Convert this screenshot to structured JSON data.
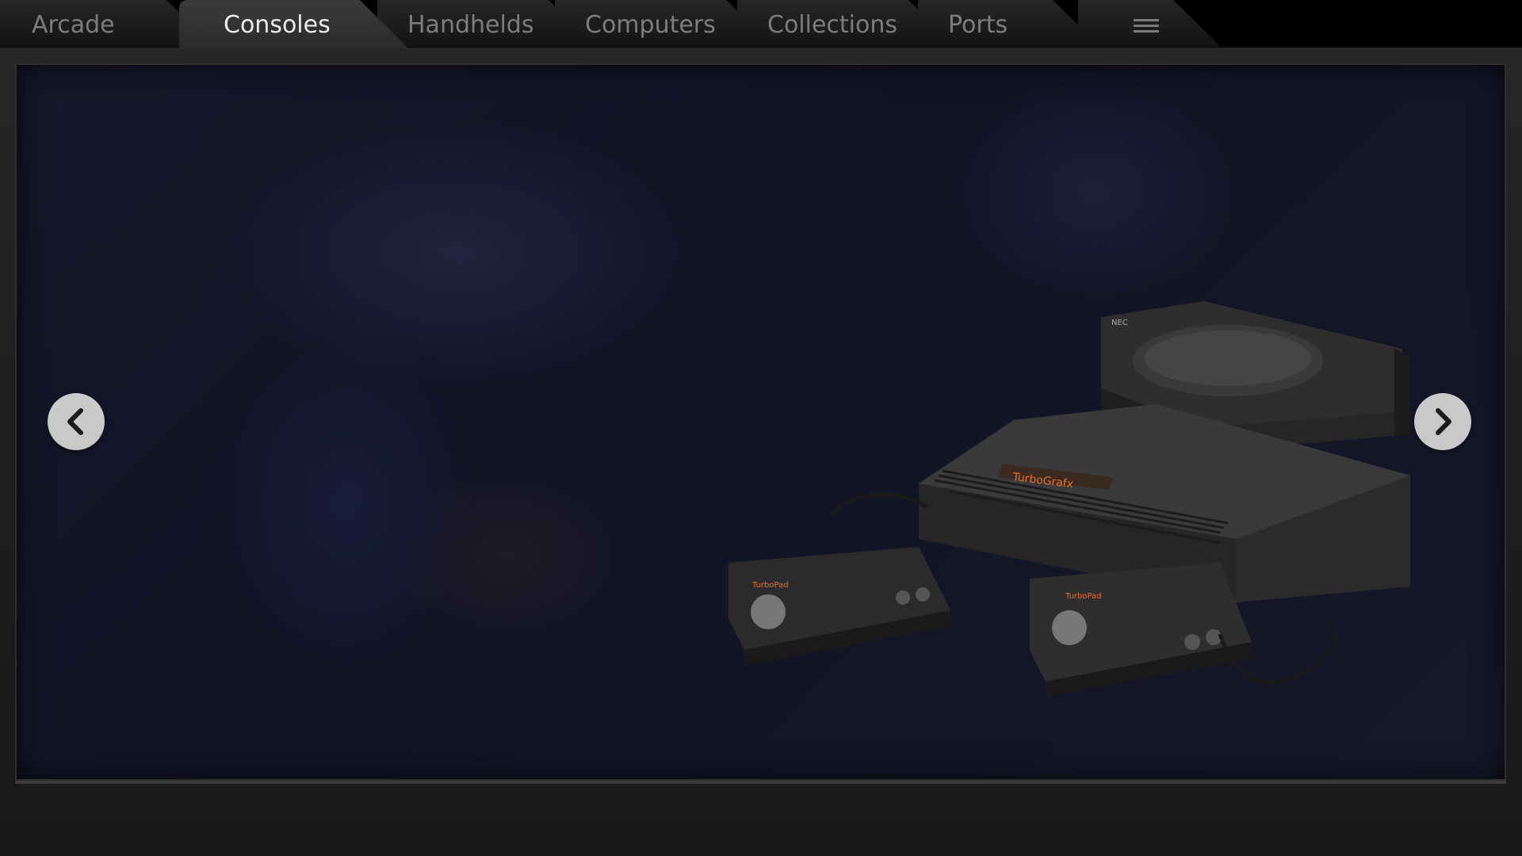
{
  "tabs": [
    {
      "label": "Arcade"
    },
    {
      "label": "Consoles"
    },
    {
      "label": "Handhelds"
    },
    {
      "label": "Computers"
    },
    {
      "label": "Collections"
    },
    {
      "label": "Ports"
    }
  ],
  "active_tab": "Consoles",
  "menu_icon": "hamburger-menu-icon",
  "carousel": {
    "prev_icon": "chevron-left-icon",
    "next_icon": "chevron-right-icon",
    "image_subject": "turbografx-console-icon",
    "console_brand_text": "TurboGrafx",
    "controller_text": "TurboPad",
    "cd_brand_text": "NEC"
  },
  "colors": {
    "tab_text": "#7d7d7d",
    "active_tab_text": "#ececec",
    "stage_bg": "#13162a",
    "nav_button": "#c9c9c9",
    "brand_label": "#e8702a"
  }
}
